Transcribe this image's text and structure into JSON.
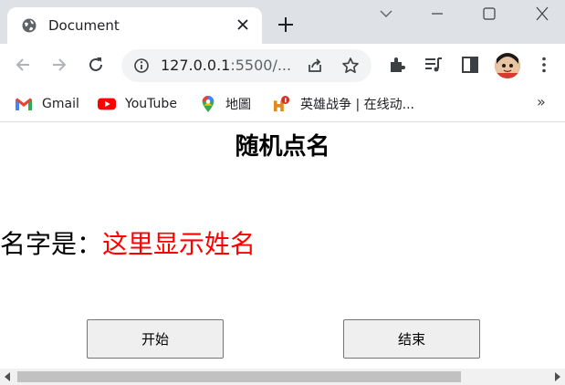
{
  "tab": {
    "title": "Document",
    "favicon": "globe-icon"
  },
  "toolbar": {
    "url_host": "127.0.0.1",
    "url_rest": ":5500/..."
  },
  "bookmarks": [
    {
      "label": "Gmail",
      "icon": "gmail-icon"
    },
    {
      "label": "YouTube",
      "icon": "youtube-icon"
    },
    {
      "label": "地圖",
      "icon": "maps-icon"
    },
    {
      "label": "英雄战争 | 在线动...",
      "icon": "hero-game-icon"
    }
  ],
  "bookmarks_more": "»",
  "page": {
    "title": "随机点名",
    "name_label": "名字是：",
    "name_value": "这里显示姓名",
    "start_button": "开始",
    "end_button": "结束"
  },
  "colors": {
    "accent_red": "#ff0000",
    "tab_bar": "#dee1e6",
    "button_bg": "#efefef"
  }
}
